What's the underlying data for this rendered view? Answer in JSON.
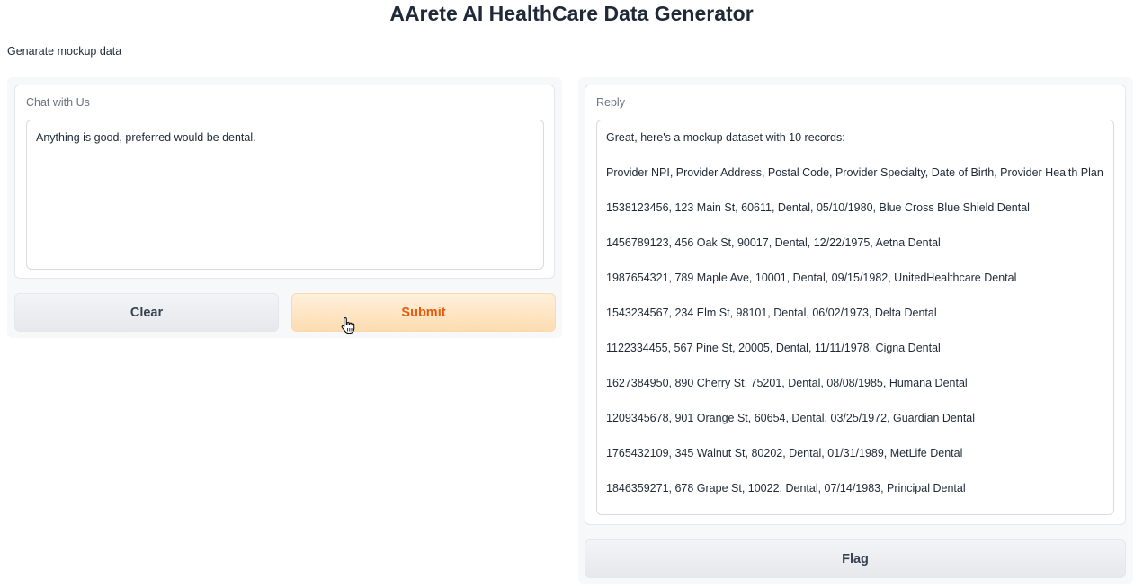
{
  "header": {
    "title": "AArete AI HealthCare Data Generator",
    "subtitle": "Genarate mockup data"
  },
  "chat": {
    "label": "Chat with Us",
    "input_value": "Anything is good, preferred would be dental."
  },
  "buttons": {
    "clear_label": "Clear",
    "submit_label": "Submit",
    "flag_label": "Flag"
  },
  "reply": {
    "label": "Reply",
    "lines": [
      "Great, here's a mockup dataset with 10 records:",
      "Provider NPI, Provider Address, Postal Code, Provider Specialty, Date of Birth, Provider Health Plan",
      "1538123456, 123 Main St, 60611, Dental, 05/10/1980, Blue Cross Blue Shield Dental",
      "1456789123, 456 Oak St, 90017, Dental, 12/22/1975, Aetna Dental",
      "1987654321, 789 Maple Ave, 10001, Dental, 09/15/1982, UnitedHealthcare Dental",
      "1543234567, 234 Elm St, 98101, Dental, 06/02/1973, Delta Dental",
      "1122334455, 567 Pine St, 20005, Dental, 11/11/1978, Cigna Dental",
      "1627384950, 890 Cherry St, 75201, Dental, 08/08/1985, Humana Dental",
      "1209345678, 901 Orange St, 60654, Dental, 03/25/1972, Guardian Dental",
      "1765432109, 345 Walnut St, 80202, Dental, 01/31/1989, MetLife Dental",
      "1846359271, 678 Grape St, 10022, Dental, 07/14/1983, Principal Dental"
    ]
  },
  "colors": {
    "primary_text": "#ea580c",
    "primary_bg": "#fddcb0",
    "panel_bg": "#f7f8fa"
  }
}
